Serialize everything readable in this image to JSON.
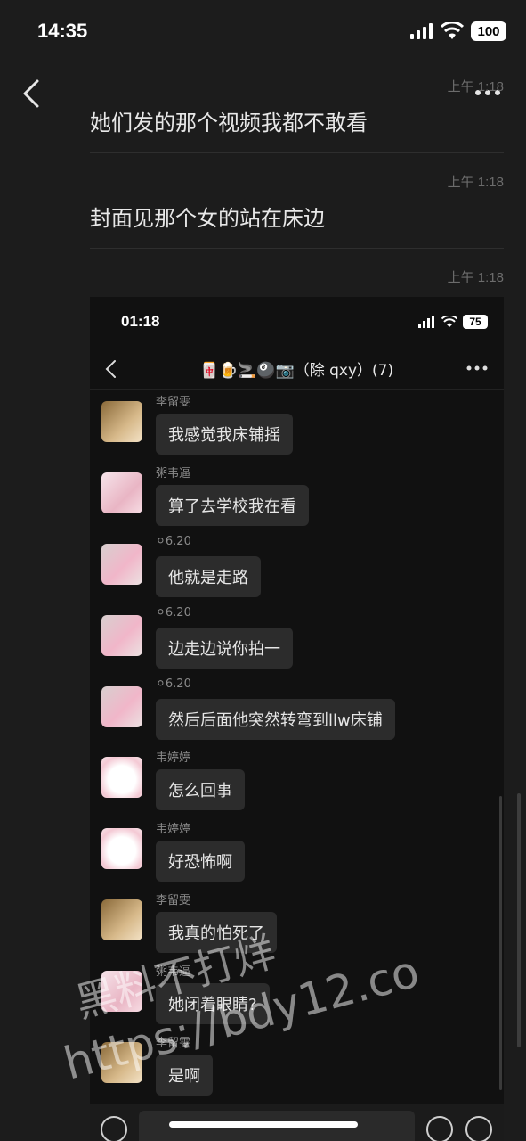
{
  "status_bar": {
    "time": "14:35",
    "battery": "100"
  },
  "messages": [
    {
      "time": "上午 1:18",
      "text": "她们发的那个视频我都不敢看"
    },
    {
      "time": "上午 1:18",
      "text": "封面见那个女的站在床边"
    },
    {
      "time": "上午 1:18",
      "text": ""
    }
  ],
  "screenshot": {
    "status_time": "01:18",
    "battery": "75",
    "title": "🀄🍺🚬🎱📷（除 qxy）(7)",
    "chat": [
      {
        "sender": "李留雯",
        "text": "我感觉我床铺摇"
      },
      {
        "sender": "粥韦逼",
        "text": "算了去学校我在看"
      },
      {
        "sender": "⚪6.20",
        "text": "他就是走路"
      },
      {
        "sender": "⚪6.20",
        "text": "边走边说你拍一"
      },
      {
        "sender": "⚪6.20",
        "text": "然后后面他突然转弯到llw床铺"
      },
      {
        "sender": "韦婷婷",
        "text": "怎么回事"
      },
      {
        "sender": "韦婷婷",
        "text": "好恐怖啊"
      },
      {
        "sender": "李留雯",
        "text": "我真的怕死了"
      },
      {
        "sender": "粥韦逼",
        "text": "她闭着眼睛?"
      },
      {
        "sender": "李留雯",
        "text": "是啊"
      }
    ]
  },
  "watermark": {
    "line1": "黑料不打烊",
    "line2": "https://bdy12.co"
  }
}
